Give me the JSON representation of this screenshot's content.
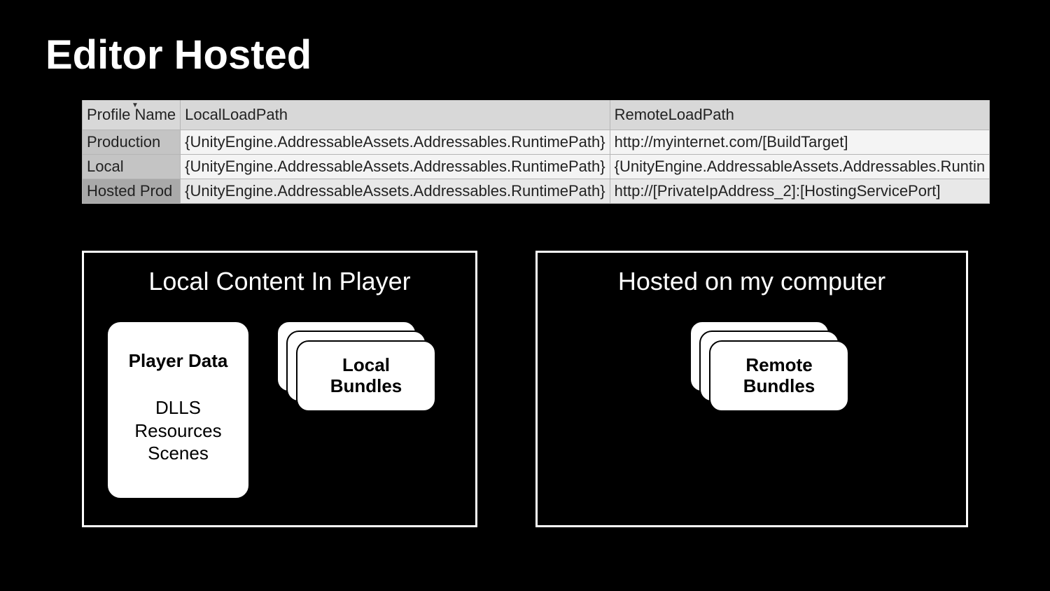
{
  "title": "Editor Hosted",
  "table": {
    "headers": {
      "name": "Profile Name",
      "local": "LocalLoadPath",
      "remote": "RemoteLoadPath"
    },
    "rows": [
      {
        "name": "Production",
        "local": "{UnityEngine.AddressableAssets.Addressables.RuntimePath}",
        "remote": "http://myinternet.com/[BuildTarget]"
      },
      {
        "name": "Local",
        "local": "{UnityEngine.AddressableAssets.Addressables.RuntimePath}",
        "remote": "{UnityEngine.AddressableAssets.Addressables.Runtin"
      },
      {
        "name": "Hosted Prod",
        "local": "{UnityEngine.AddressableAssets.Addressables.RuntimePath}",
        "remote": "http://[PrivateIpAddress_2]:[HostingServicePort]"
      }
    ],
    "selected_index": 2
  },
  "left_box": {
    "title": "Local Content In Player",
    "player_data": {
      "title": "Player Data",
      "line1": "DLLS",
      "line2": "Resources",
      "line3": "Scenes"
    },
    "bundle_label_1": "Local",
    "bundle_label_2": "Bundles"
  },
  "right_box": {
    "title": "Hosted on my computer",
    "bundle_label_1": "Remote",
    "bundle_label_2": "Bundles"
  }
}
